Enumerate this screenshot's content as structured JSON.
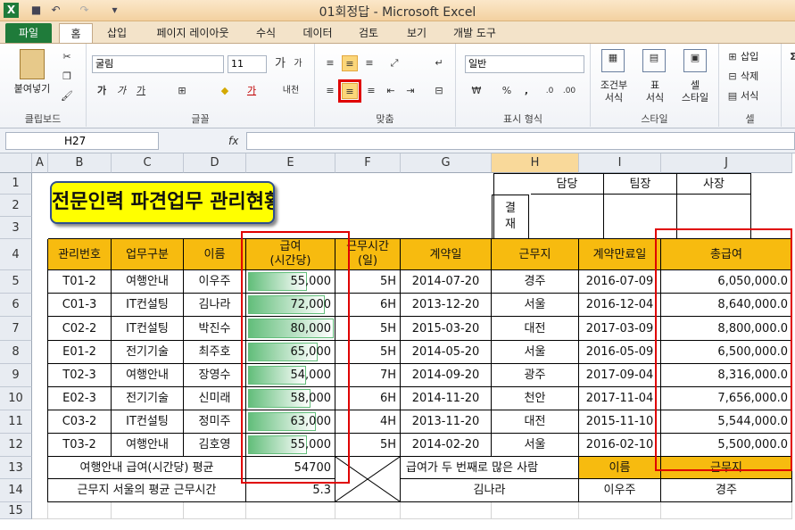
{
  "window": {
    "title": "01회정답 - Microsoft Excel",
    "logo": "X"
  },
  "quick_access": [
    "save-icon",
    "undo-icon",
    "redo-icon",
    "customize-icon"
  ],
  "tabs": [
    "파일",
    "홈",
    "삽입",
    "페이지 레이아웃",
    "수식",
    "데이터",
    "검토",
    "보기",
    "개발 도구"
  ],
  "ribbon": {
    "clipboard": {
      "paste": "붙여넣기",
      "label": "클립보드"
    },
    "font": {
      "name": "굴림",
      "size": "11",
      "grow": "가",
      "shrink": "가",
      "bold": "가",
      "italic": "가",
      "underline": "가",
      "fill_icon": "◆",
      "font_color_icon": "가",
      "phonetic": "내천",
      "label": "글꼴"
    },
    "align": {
      "label": "맞춤"
    },
    "number": {
      "format": "일반",
      "label": "표시 형식",
      "percent": "%",
      "comma": ","
    },
    "styles": {
      "cond": "조건부\n서식",
      "table": "표\n서식",
      "cell": "셀\n스타일",
      "label": "스타일"
    },
    "cells": {
      "insert": "삽입",
      "delete": "삭제",
      "format": "서식",
      "label": "셀"
    },
    "editing_icon": "Σ"
  },
  "formula_bar": {
    "name_box": "H27",
    "fx": "fx",
    "value": ""
  },
  "columns": [
    "A",
    "B",
    "C",
    "D",
    "E",
    "F",
    "G",
    "H",
    "I",
    "J"
  ],
  "rows": [
    "1",
    "2",
    "3",
    "4",
    "5",
    "6",
    "7",
    "8",
    "9",
    "10",
    "11",
    "12",
    "13",
    "14",
    "15"
  ],
  "sheet": {
    "title": "전문인력 파견업무 관리현황",
    "approval": {
      "label": "결\n재",
      "roles": [
        "담당",
        "팀장",
        "사장"
      ]
    },
    "headers": [
      "관리번호",
      "업무구분",
      "이름",
      "급여\n(시간당)",
      "근무시간\n(일)",
      "계약일",
      "근무지",
      "계약만료일",
      "총급여"
    ],
    "records": [
      [
        "T01-2",
        "여행안내",
        "이우주",
        "55,000",
        "5H",
        "2014-07-20",
        "경주",
        "2016-07-09",
        "6,050,000.0"
      ],
      [
        "C01-3",
        "IT컨설팅",
        "김나라",
        "72,000",
        "6H",
        "2013-12-20",
        "서울",
        "2016-12-04",
        "8,640,000.0"
      ],
      [
        "C02-2",
        "IT컨설팅",
        "박진수",
        "80,000",
        "5H",
        "2015-03-20",
        "대전",
        "2017-03-09",
        "8,800,000.0"
      ],
      [
        "E01-2",
        "전기기술",
        "최주호",
        "65,000",
        "5H",
        "2014-05-20",
        "서울",
        "2016-05-09",
        "6,500,000.0"
      ],
      [
        "T02-3",
        "여행안내",
        "장영수",
        "54,000",
        "7H",
        "2014-09-20",
        "광주",
        "2017-09-04",
        "8,316,000.0"
      ],
      [
        "E02-3",
        "전기기술",
        "신미래",
        "58,000",
        "6H",
        "2014-11-20",
        "천안",
        "2017-11-04",
        "7,656,000.0"
      ],
      [
        "C03-2",
        "IT컨설팅",
        "정미주",
        "63,000",
        "4H",
        "2013-11-20",
        "대전",
        "2015-11-10",
        "5,544,000.0"
      ],
      [
        "T03-2",
        "여행안내",
        "김호영",
        "55,000",
        "5H",
        "2014-02-20",
        "서울",
        "2016-02-10",
        "5,500,000.0"
      ]
    ],
    "summary": {
      "r13_label": "여행안내 급여(시간당) 평균",
      "r13_value": "54700",
      "r14_label": "근무지 서울의 평균 근무시간",
      "r14_value": "5.3",
      "q_label": "급여가 두 번째로 많은 사람",
      "q_head1": "이름",
      "q_head2": "근무지",
      "q_val": "김나라",
      "q_name": "이우주",
      "q_place": "경주"
    }
  },
  "databar": {
    "min": 0,
    "max": 80000,
    "color": "#63be7b"
  }
}
